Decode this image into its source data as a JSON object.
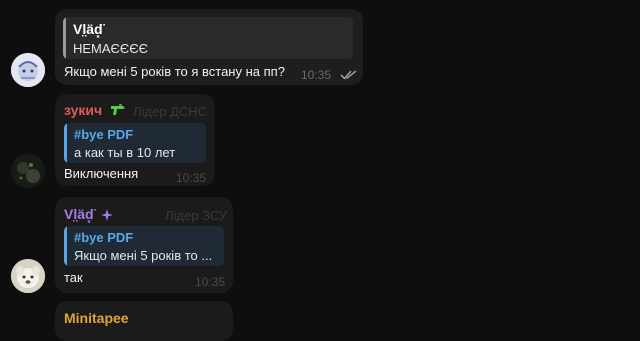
{
  "messages": [
    {
      "reply": {
        "name": "Vl̤äd͓̈",
        "text": "НЕМАЄЄЄЄ"
      },
      "text": "Якщо мені 5 років то я встану на пп?",
      "time": "10:35",
      "status": "read",
      "avatar_icon": "user-avatar-drawing-icon"
    },
    {
      "sender": "зукич",
      "sender_emoji": "water-gun-icon",
      "sender_color": "#e05a5a",
      "role": "Лідер ДСНС",
      "reply": {
        "name": "#bye PDF",
        "text": "а как ты в 10 лет"
      },
      "text": "Виключення",
      "time": "10:35",
      "avatar_icon": "dark-avatar-icon"
    },
    {
      "sender": "Vl̤äd͓̈",
      "sender_emoji": "sparkle-icon",
      "sender_color": "#a77ce8",
      "role": "Лідер ЗСУ",
      "reply": {
        "name": "#bye PDF",
        "text": "Якщо мені 5 років то ..."
      },
      "text": "так",
      "time": "10:35",
      "avatar_icon": "white-dog-avatar-icon"
    },
    {
      "sender": "Minitapee",
      "sender_color": "#e0a43a"
    }
  ],
  "colors": {
    "reply_blue": "#5aa6e6",
    "reply_gray_bar": "#8a8a8a",
    "bubble": "#1b1b1b",
    "background": "#0e0e0e",
    "check": "#9a9a9a"
  }
}
